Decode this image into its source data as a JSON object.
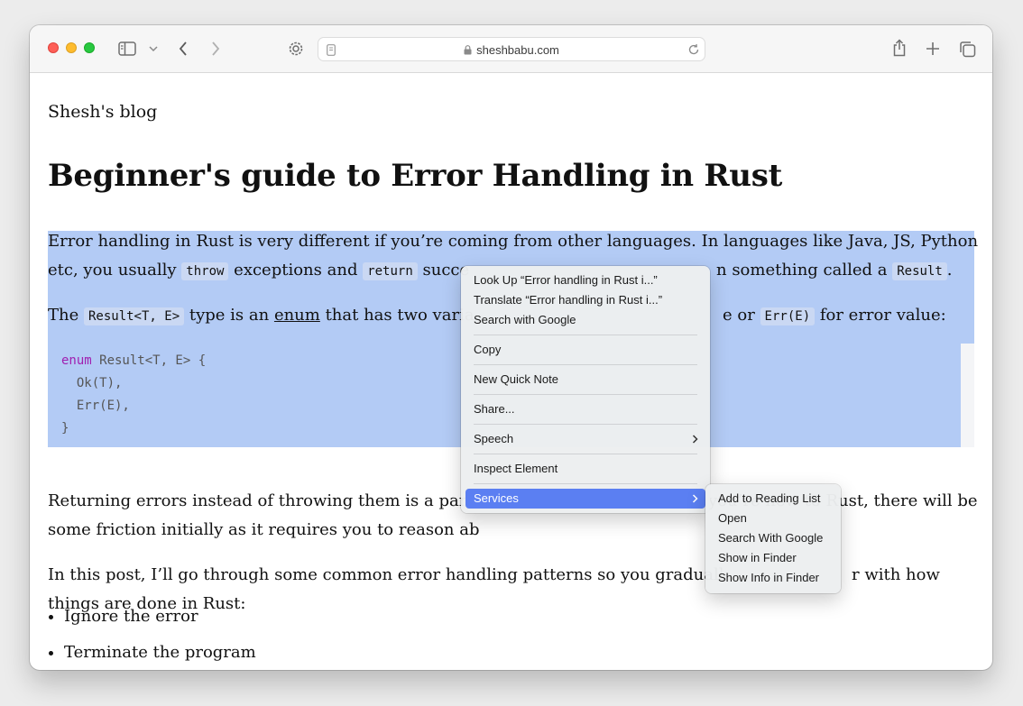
{
  "browser": {
    "url": "sheshbabu.com",
    "icons": [
      "sidebar-icon",
      "chevron-down-icon",
      "back-icon",
      "forward-icon",
      "settings-icon",
      "reader-icon",
      "lock-icon",
      "reload-icon",
      "share-icon",
      "new-tab-icon",
      "tab-overview-icon"
    ]
  },
  "page": {
    "site_title": "Shesh's blog",
    "post_title": "Beginner's guide to Error Handling in Rust",
    "p1": {
      "line1": "Error handling in Rust is very different if you’re coming from other languages. In languages like Java, JS, Python",
      "line2_a": "etc, you usually ",
      "code_throw": "throw",
      "line2_b": " exceptions and ",
      "code_return": "return",
      "line2_c": " succe",
      "line2_d": "n something called a ",
      "code_result": "Result",
      "line2_e": "."
    },
    "p2": {
      "a": "The ",
      "code_result_te": "Result<T, E>",
      "b": " type is an ",
      "link_enum": "enum",
      "c": " that has two varia",
      "d": "e or ",
      "code_err": "Err(E)",
      "e": " for error value:"
    },
    "code": {
      "l1_kw": "enum",
      "l1_rest": " Result<T, E> {",
      "l2": "  Ok(T),",
      "l3": "  Err(E),",
      "l4": "}"
    },
    "p3": {
      "line1_a": "Returning errors instead of throwing them is a parad",
      "line1_b": "you’re new to Rust, there will be",
      "line2": "some friction initially as it requires you to reason ab"
    },
    "p4": {
      "line1_a": "In this post, I’ll go through some common error handling patterns so you graduall",
      "line1_b": "r with how",
      "line2": "things are done in Rust:"
    },
    "list": [
      "Ignore the error",
      "Terminate the program"
    ]
  },
  "context_menu": {
    "items": [
      "Look Up “Error handling in Rust i...”",
      "Translate “Error handling in Rust i...”",
      "Search with Google",
      "Copy",
      "New Quick Note",
      "Share...",
      "Speech",
      "Inspect Element",
      "Services"
    ],
    "highlighted": "Services",
    "accent": "#5b7ff2"
  },
  "services_menu": {
    "items": [
      "Add to Reading List",
      "Open",
      "Search With Google",
      "Show in Finder",
      "Show Info in Finder"
    ]
  },
  "colors": {
    "selection": "#b3cbf5",
    "code_keyword": "#a020b0"
  }
}
